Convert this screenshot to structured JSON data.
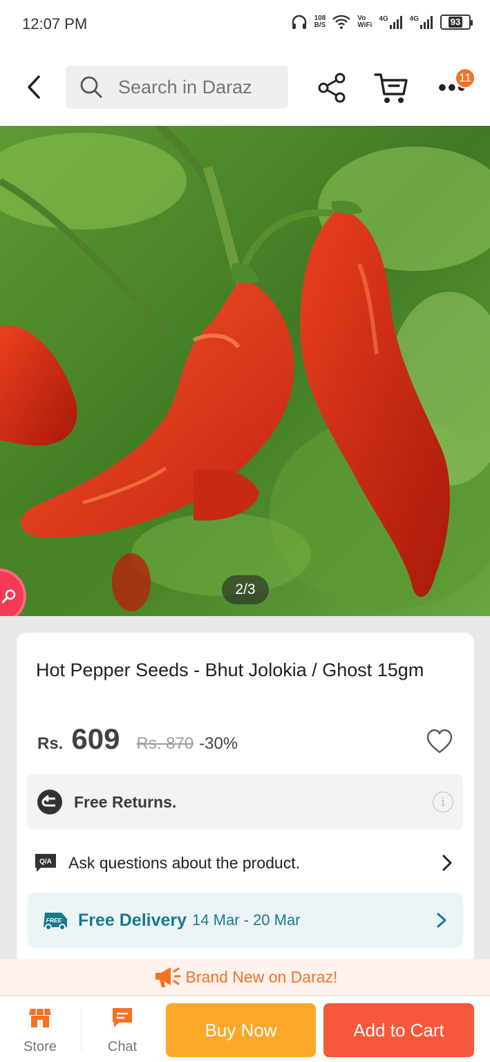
{
  "status_bar": {
    "time": "12:07 PM",
    "net_speed_value": "108",
    "net_speed_unit": "B/S",
    "vowifi_top": "Vo",
    "vowifi_bottom": "WiFi",
    "sim1_label": "4G",
    "sim2_label": "4G",
    "battery_level": "93"
  },
  "header": {
    "search_placeholder": "Search in Daraz",
    "more_badge_count": "11"
  },
  "gallery": {
    "counter": "2/3"
  },
  "product": {
    "title": "Hot Pepper Seeds - Bhut Jolokia / Ghost 15gm",
    "currency": "Rs.",
    "price": "609",
    "original_price": "Rs. 870",
    "discount": "-30%"
  },
  "services": {
    "returns_label": "Free Returns.",
    "info_glyph": "i",
    "qa_icon_text": "Q/A",
    "qa_label": "Ask questions about the product.",
    "free_icon_text": "FREE",
    "delivery_title": "Free Delivery",
    "delivery_dates": "14 Mar - 20 Mar"
  },
  "promo": {
    "text": "Brand New on Daraz!"
  },
  "bottom_bar": {
    "store_label": "Store",
    "chat_label": "Chat",
    "buy_now_label": "Buy Now",
    "add_to_cart_label": "Add to Cart"
  },
  "colors": {
    "brand_orange": "#f57224",
    "buy_now": "#fba829",
    "add_to_cart": "#f7573a",
    "delivery_teal": "#177b8a"
  }
}
